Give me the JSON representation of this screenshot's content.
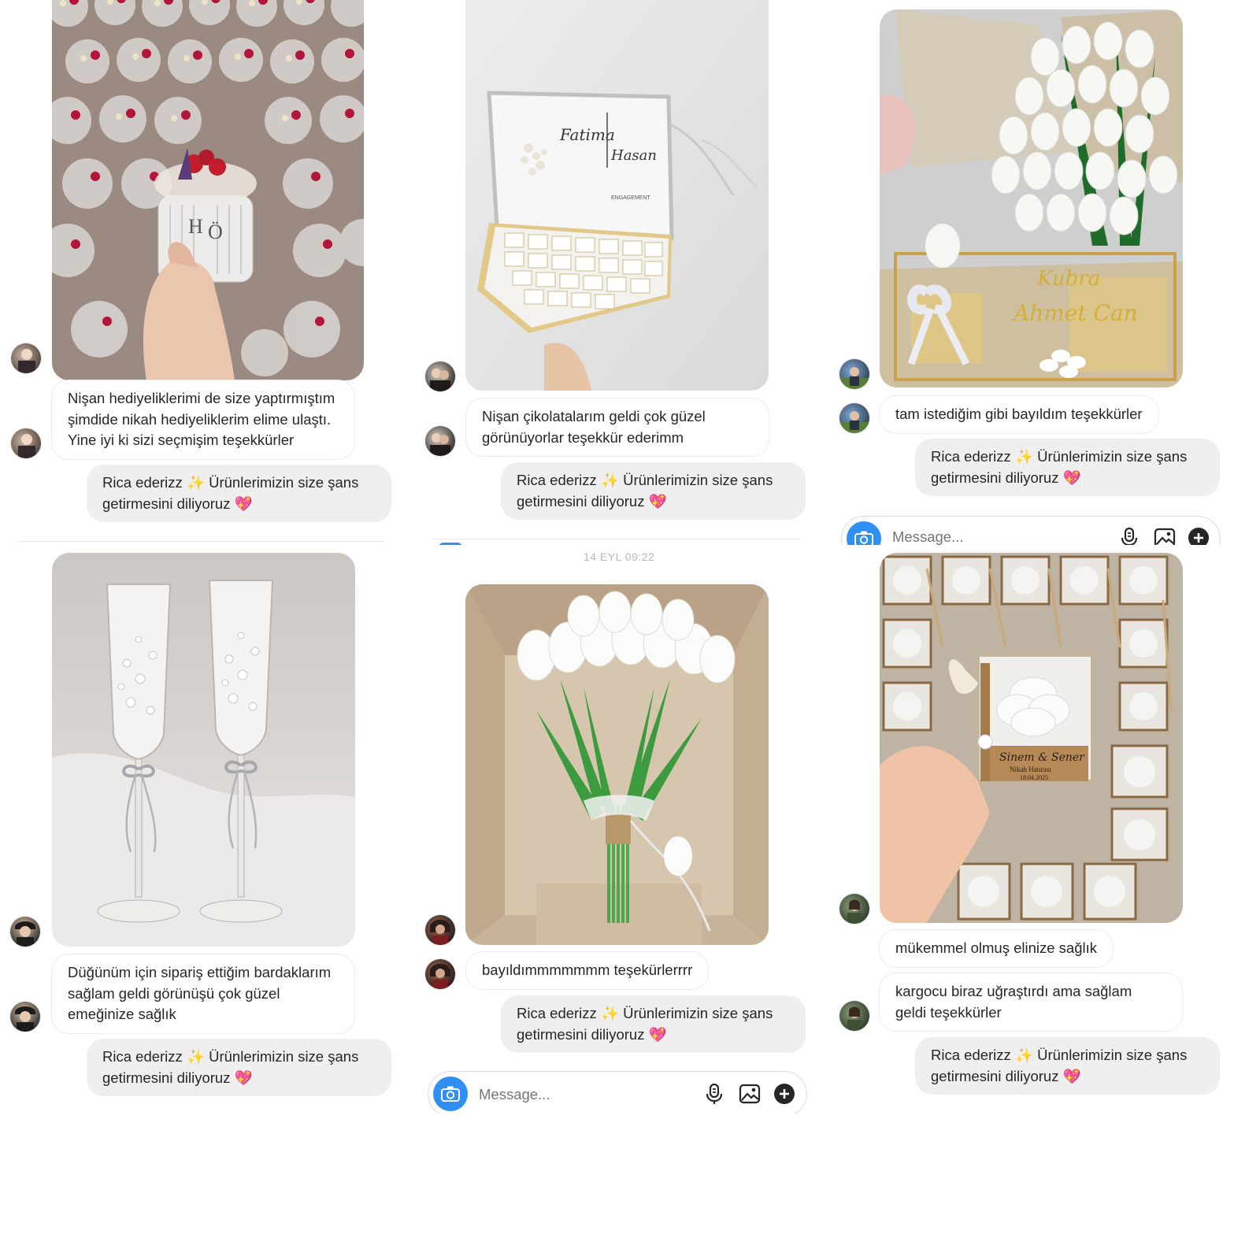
{
  "colors": {
    "accent": "#2f8ff3",
    "incoming_bg": "#ffffff",
    "outgoing_bg": "#efefef",
    "sparkle": "#f5a623",
    "heart": "#e8336e"
  },
  "reply": {
    "line1_prefix": "Rica ederizz ",
    "sparkle": "✨",
    "line1_suffix": " Ürünlerimizin size şans",
    "line2": "getirmesini diliyoruz ",
    "heart": "💖"
  },
  "composer": {
    "placeholder": "Message...",
    "icons": [
      "camera-icon",
      "microphone-icon",
      "image-icon",
      "plus-icon"
    ]
  },
  "panels": [
    {
      "photo_subject": "candle favors with dried flowers",
      "messages": [
        "Nişan hediyeliklerimi de size yaptırmıştım\nşimdide nikah hediyeliklerim elime ulaştı.\nYine iyi ki sizi seçmişim teşekkürler"
      ]
    },
    {
      "photo_subject": "engagement chocolate box",
      "photo_text": {
        "name1": "Fatima",
        "name2": "Hasan",
        "caption": "ENGAGEMENT"
      },
      "messages": [
        "Nişan çikolatalarım geldi çok güzel\ngörünüyorlar teşekkür ederimm"
      ]
    },
    {
      "photo_subject": "white tulip bouquet with gold box",
      "photo_text": {
        "name1": "Kubra",
        "name2": "Ahmet Can"
      },
      "messages": [
        "tam istediğim gibi bayıldım teşekkürler"
      ]
    },
    {
      "photo_subject": "pearl champagne glasses",
      "messages": [
        "Düğünüm için sipariş ettiğim bardaklarım\nsağlam geldi görünüşü çok güzel\nemeğinize sağlık"
      ]
    },
    {
      "timestamp": "14 EYL 09:22",
      "photo_subject": "white tulip bouquet in box",
      "messages": [
        "bayıldımmmmmmm teşekürlerrrr"
      ]
    },
    {
      "photo_subject": "wax flower favors with names",
      "photo_text": {
        "name1": "Sinem & Sener",
        "caption": "Nikah Hatırası",
        "date": "18.04.2025"
      },
      "messages": [
        "mükemmel olmuş elinize sağlık",
        "kargocu biraz uğraştırdı ama sağlam\ngeldi teşekkürler"
      ]
    }
  ]
}
